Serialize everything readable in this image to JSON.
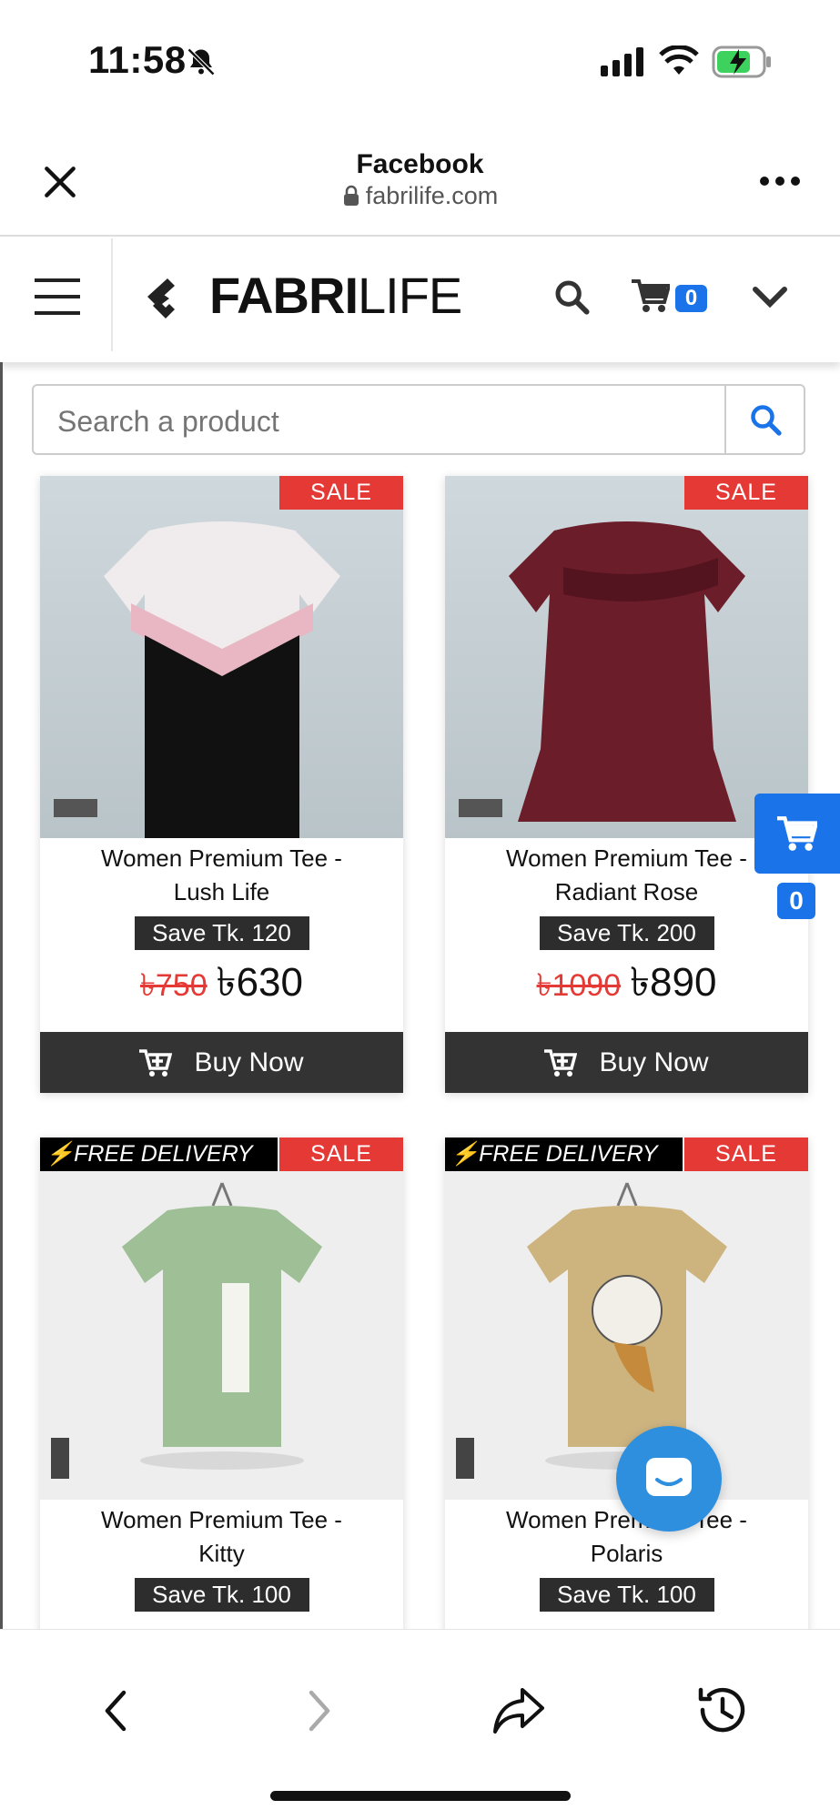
{
  "status": {
    "time": "11:58"
  },
  "fb_header": {
    "title": "Facebook",
    "url": "fabrilife.com"
  },
  "site": {
    "brand_bold": "FABRI",
    "brand_light": "LIFE",
    "cart_count": "0"
  },
  "search": {
    "placeholder": "Search a product"
  },
  "products": [
    {
      "name_line1": "Women Premium Tee -",
      "name_line2": "Lush Life",
      "save": "Save Tk. 120",
      "old_price": "৳750",
      "price": "৳630",
      "badge": "SALE",
      "buy": "Buy Now"
    },
    {
      "name_line1": "Women Premium Tee -",
      "name_line2": "Radiant Rose",
      "save": "Save Tk. 200",
      "old_price": "৳1090",
      "price": "৳890",
      "badge": "SALE",
      "buy": "Buy Now"
    },
    {
      "name_line1": "Women Premium Tee -",
      "name_line2": "Kitty",
      "save": "Save Tk. 100",
      "badge": "SALE",
      "delivery": "FREE DELIVERY"
    },
    {
      "name_line1": "Women Premium Tee -",
      "name_line2": "Polaris",
      "save": "Save Tk. 100",
      "badge": "SALE",
      "delivery": "FREE DELIVERY"
    }
  ],
  "floating_cart": {
    "count": "0"
  },
  "icons": [
    "close-icon",
    "more-icon",
    "lock-icon",
    "menu-icon",
    "search-icon",
    "cart-icon",
    "chevron-down-icon",
    "chat-icon",
    "back-icon",
    "forward-icon",
    "share-icon",
    "history-icon"
  ],
  "colors": {
    "accent": "#1a73e8",
    "sale": "#e53935",
    "dark": "#333333"
  }
}
